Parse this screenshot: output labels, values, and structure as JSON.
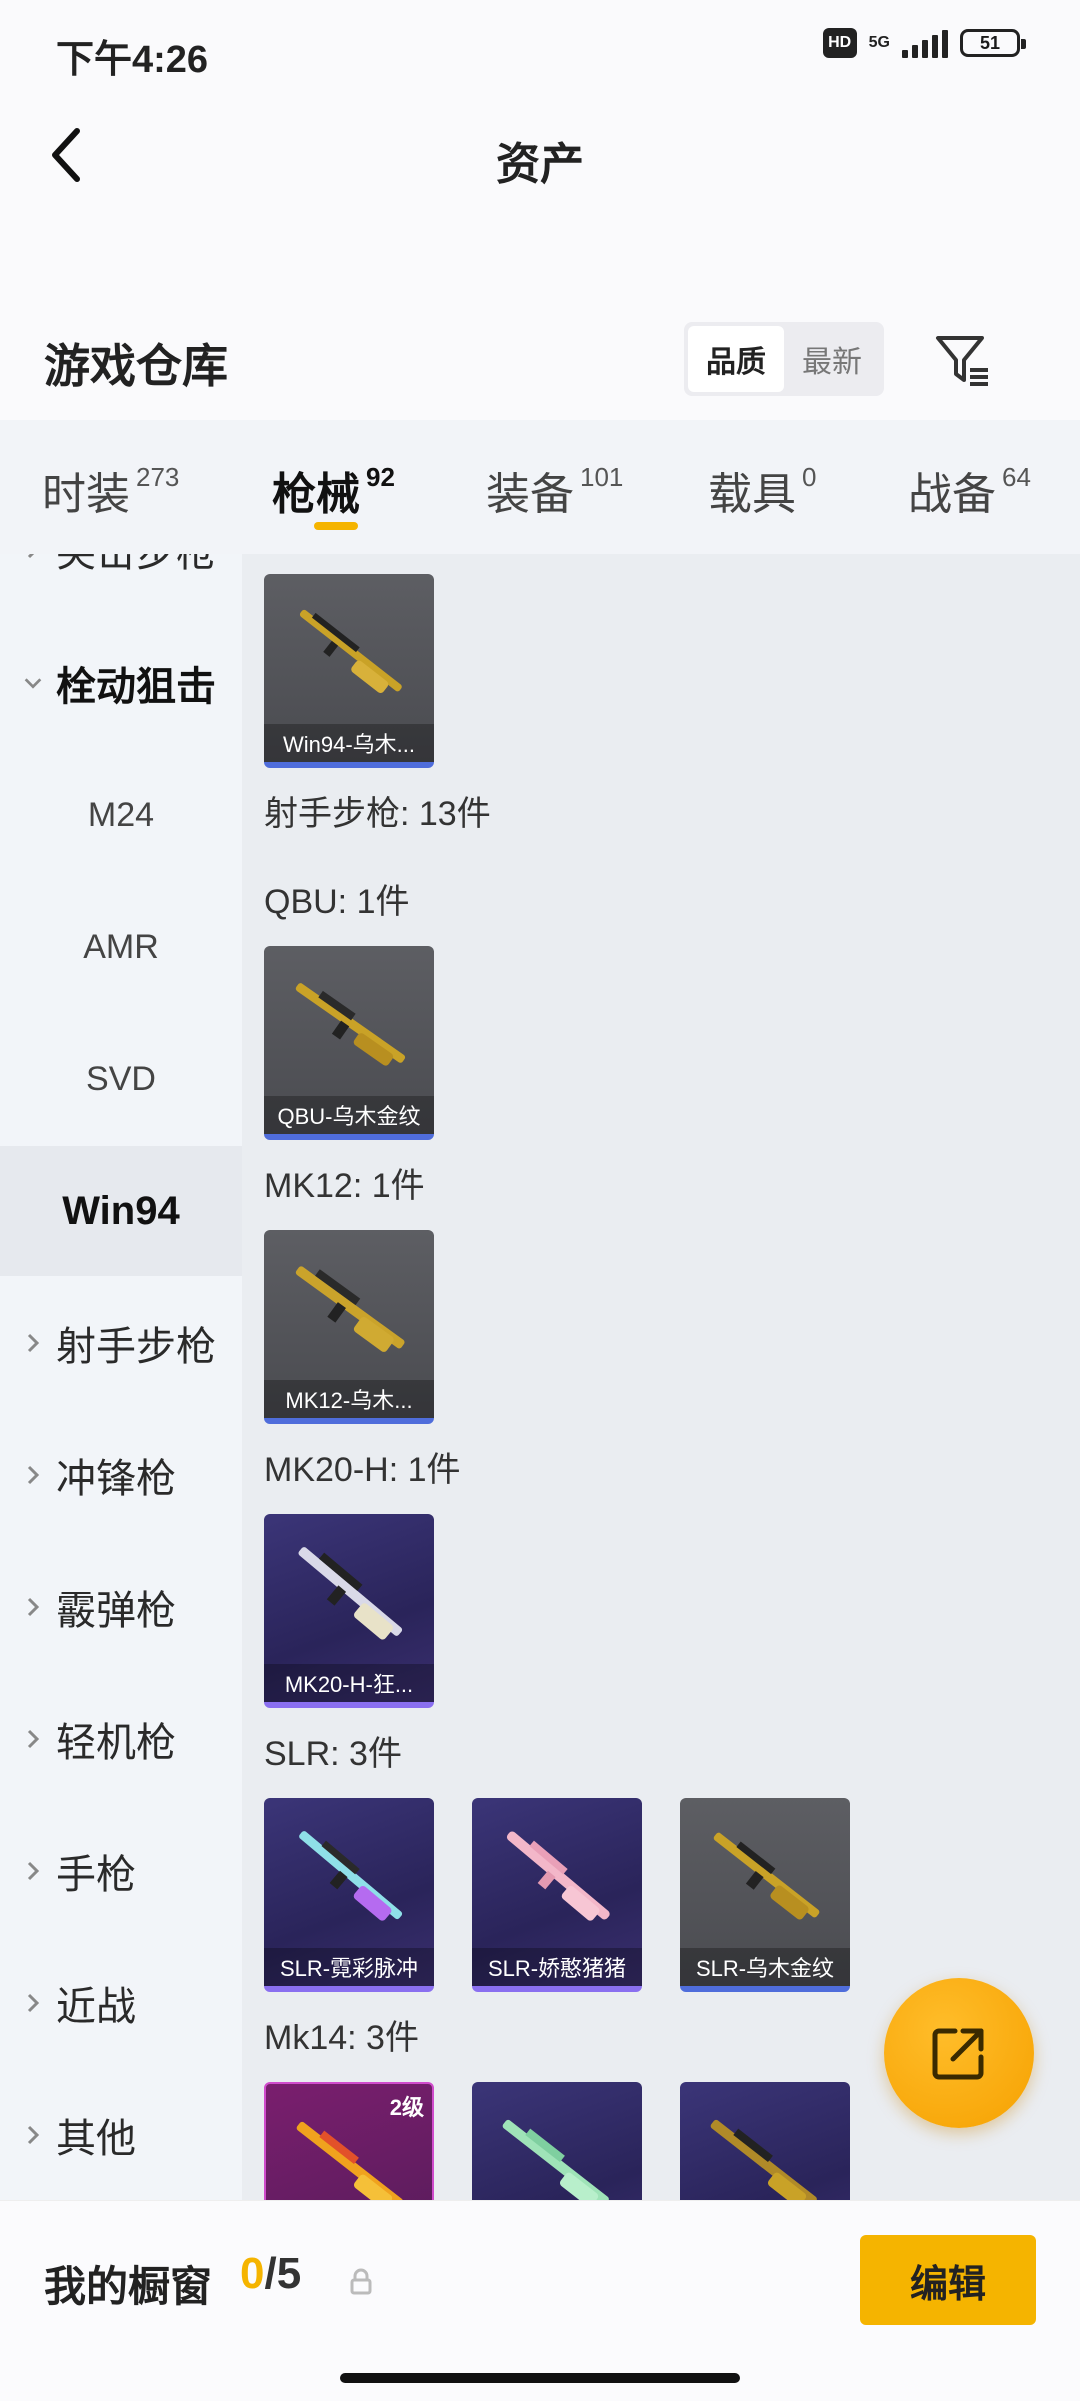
{
  "status_bar": {
    "time": "下午4:26",
    "hd": "HD",
    "network": "5G",
    "battery": "51"
  },
  "nav": {
    "title": "资产"
  },
  "warehouse": {
    "title": "游戏仓库",
    "sort_options": [
      "品质",
      "最新"
    ],
    "sort_selected": "品质"
  },
  "tabs": [
    {
      "label": "时装",
      "count": "273"
    },
    {
      "label": "枪械",
      "count": "92"
    },
    {
      "label": "装备",
      "count": "101"
    },
    {
      "label": "载具",
      "count": "0"
    },
    {
      "label": "战备",
      "count": "64"
    }
  ],
  "active_tab": "枪械",
  "sidebar": {
    "items": [
      {
        "label": "突击步枪"
      },
      {
        "label": "栓动狙击"
      },
      {
        "label": "M24"
      },
      {
        "label": "AMR"
      },
      {
        "label": "SVD"
      },
      {
        "label": "Win94"
      },
      {
        "label": "射手步枪"
      },
      {
        "label": "冲锋枪"
      },
      {
        "label": "霰弹枪"
      },
      {
        "label": "轻机枪"
      },
      {
        "label": "手枪"
      },
      {
        "label": "近战"
      },
      {
        "label": "其他"
      }
    ],
    "selected": "Win94"
  },
  "content": {
    "sections": [
      {
        "title": "",
        "items": [
          {
            "name": "Win94-乌木..."
          }
        ]
      },
      {
        "title": "射手步枪: 13件"
      },
      {
        "title": "QBU: 1件",
        "items": [
          {
            "name": "QBU-乌木金纹"
          }
        ]
      },
      {
        "title": "MK12: 1件",
        "items": [
          {
            "name": "MK12-乌木..."
          }
        ]
      },
      {
        "title": "MK20-H: 1件",
        "items": [
          {
            "name": "MK20-H-狂..."
          }
        ]
      },
      {
        "title": "SLR: 3件",
        "items": [
          {
            "name": "SLR-霓彩脉冲"
          },
          {
            "name": "SLR-娇憨猪猪"
          },
          {
            "name": "SLR-乌木金纹"
          }
        ]
      },
      {
        "title": "Mk14: 3件",
        "items": [
          {
            "level": "2级"
          },
          {},
          {}
        ]
      }
    ]
  },
  "bottom_bar": {
    "title": "我的橱窗",
    "current": "0",
    "total": "/5",
    "edit_label": "编辑"
  },
  "colors": {
    "accent": "#f5b400",
    "rarity_blue": "#4f6ddb",
    "rarity_purple": "#8a6ff0"
  }
}
